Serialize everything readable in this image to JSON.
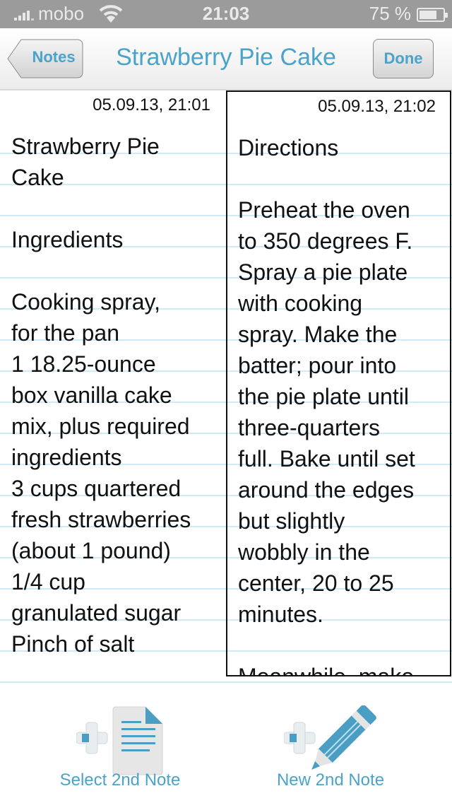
{
  "status_bar": {
    "carrier": "mobo",
    "time": "21:03",
    "battery_percent": "75 %",
    "battery_level": 0.75,
    "icons": [
      "signal-icon",
      "wifi-icon",
      "battery-icon"
    ]
  },
  "nav_bar": {
    "back_label": "Notes",
    "title": "Strawberry Pie Cake",
    "done_label": "Done"
  },
  "notes": [
    {
      "date": "05.09.13, 21:01",
      "body": "Strawberry Pie\nCake\n\nIngredients\n\nCooking spray,\nfor the pan\n1 18.25-ounce\nbox vanilla cake\nmix, plus required\ningredients\n3 cups quartered\nfresh strawberries\n(about 1 pound)\n1/4 cup\ngranulated sugar\nPinch of salt"
    },
    {
      "date": "05.09.13, 21:02",
      "body": "Directions\n\nPreheat the oven\nto 350 degrees F.\nSpray a pie plate\nwith cooking\nspray. Make the\nbatter; pour into\nthe pie plate until\nthree-quarters\nfull. Bake until set\naround the edges\nbut slightly\nwobbly in the\ncenter, 20 to 25\nminutes.\n\nMeanwhile, make"
    }
  ],
  "toolbar": {
    "select_label": "Select 2nd Note",
    "new_label": "New 2nd Note"
  },
  "colors": {
    "accent": "#4aa3c8",
    "status_bar_bg": "#9b9b9b",
    "rule_line": "#d2eaf5"
  }
}
